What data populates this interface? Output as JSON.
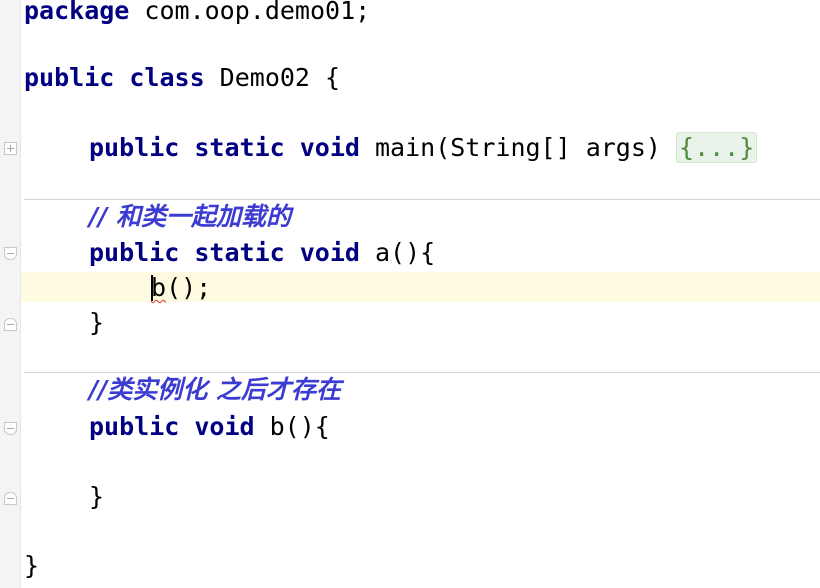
{
  "code": {
    "package_kw": "package",
    "package_name": " com.oop.demo01;",
    "class_kw": "public class",
    "class_decl": " Demo02 {",
    "main_kw": "public static void",
    "main_sig": " main(String[] args) ",
    "main_folded_body": "{...}",
    "comment_a": "// 和类一起加载的",
    "method_a_kw": "public static void",
    "method_a_sig": " a(){",
    "call_b": "b",
    "call_b_rest": "();",
    "close_brace": "}",
    "comment_b": "//类实例化 之后才存在",
    "method_b_kw": "public void",
    "method_b_sig": " b(){"
  },
  "colors": {
    "keyword": "#000080",
    "comment": "#3c3cd2",
    "folded_text": "#4f8a3f",
    "error_underline": "#e03030",
    "current_line": "#fffbe0"
  },
  "icons": {
    "fold_expand": "fold-plus-icon",
    "fold_collapse": "fold-minus-icon"
  }
}
